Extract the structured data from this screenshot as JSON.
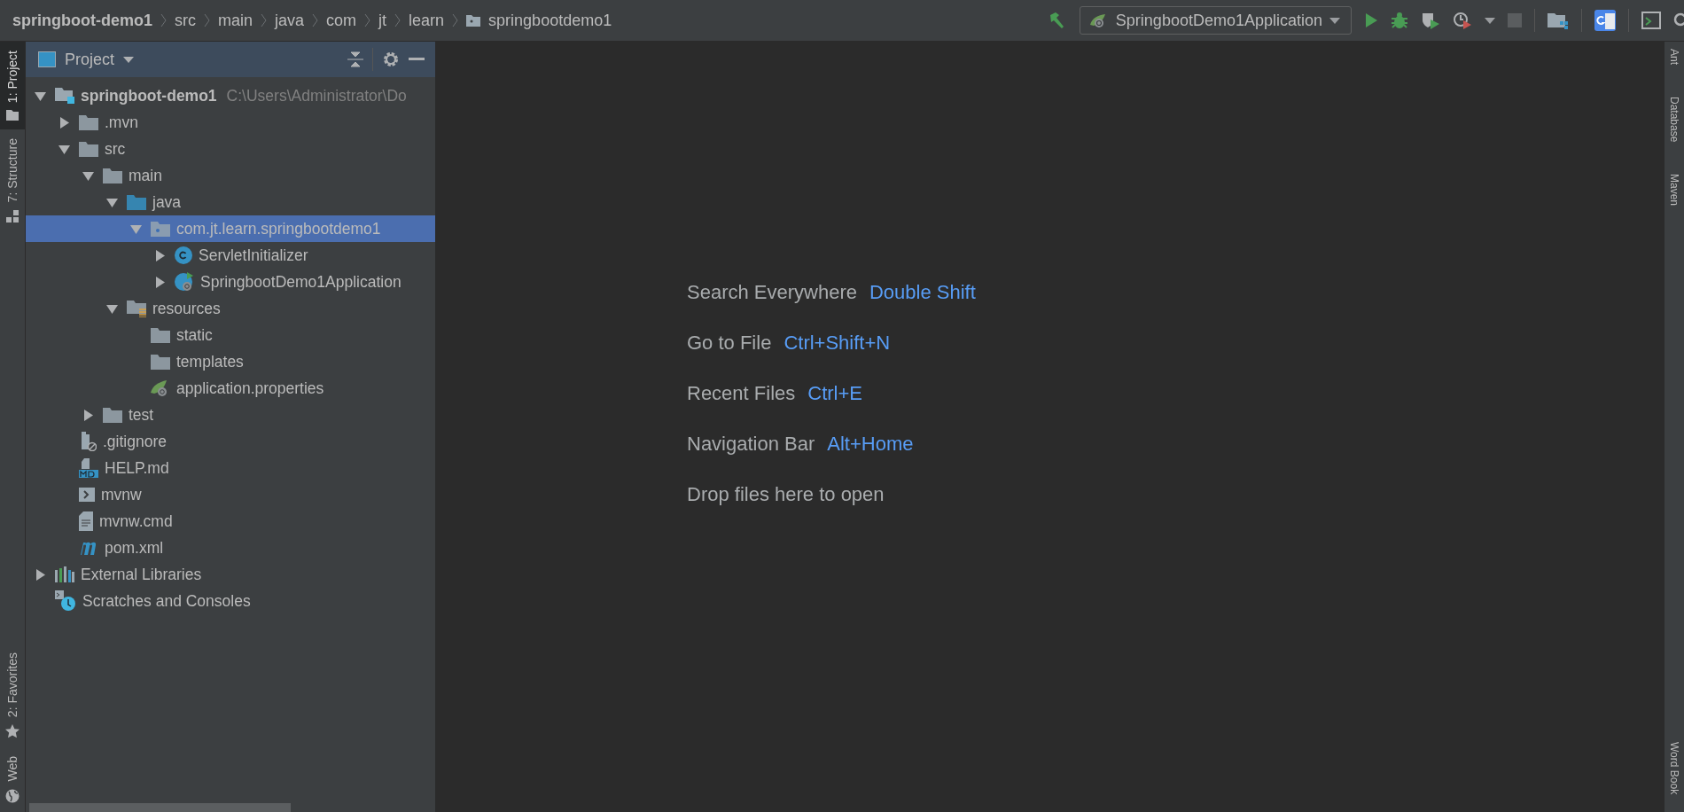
{
  "breadcrumb": [
    {
      "label": "springboot-demo1",
      "kind": "project"
    },
    {
      "label": "src",
      "kind": "plain"
    },
    {
      "label": "main",
      "kind": "plain"
    },
    {
      "label": "java",
      "kind": "plain"
    },
    {
      "label": "com",
      "kind": "plain"
    },
    {
      "label": "jt",
      "kind": "plain"
    },
    {
      "label": "learn",
      "kind": "plain"
    },
    {
      "label": "springbootdemo1",
      "kind": "package"
    }
  ],
  "run_config": {
    "label": "SpringbootDemo1Application"
  },
  "left_tool_windows": [
    {
      "label": "1: Project",
      "selected": true,
      "kind": "project"
    },
    {
      "label": "7: Structure",
      "selected": false,
      "kind": "structure"
    },
    {
      "label": "2: Favorites",
      "selected": false,
      "kind": "favorites"
    },
    {
      "label": "Web",
      "selected": false,
      "kind": "web"
    }
  ],
  "right_tool_windows": [
    {
      "label": "Ant"
    },
    {
      "label": "Database"
    },
    {
      "label": "Maven"
    },
    {
      "label": "Word Book"
    }
  ],
  "project_panel": {
    "title": "Project",
    "tree": [
      {
        "label": "springboot-demo1",
        "kind": "module",
        "hint": "C:\\Users\\Administrator\\Do",
        "expanded": true,
        "selected": false,
        "children": [
          {
            "label": ".mvn",
            "kind": "folder",
            "expanded": false,
            "selected": false
          },
          {
            "label": "src",
            "kind": "folder",
            "expanded": true,
            "selected": false,
            "children": [
              {
                "label": "main",
                "kind": "folder",
                "expanded": true,
                "selected": false,
                "children": [
                  {
                    "label": "java",
                    "kind": "source-folder",
                    "expanded": true,
                    "selected": false,
                    "children": [
                      {
                        "label": "com.jt.learn.springbootdemo1",
                        "kind": "package",
                        "expanded": true,
                        "selected": true,
                        "children": [
                          {
                            "label": "ServletInitializer",
                            "kind": "class",
                            "expanded": false,
                            "selected": false
                          },
                          {
                            "label": "SpringbootDemo1Application",
                            "kind": "spring-class",
                            "expanded": false,
                            "selected": false
                          }
                        ]
                      }
                    ]
                  },
                  {
                    "label": "resources",
                    "kind": "resources-folder",
                    "expanded": true,
                    "selected": false,
                    "children": [
                      {
                        "label": "static",
                        "kind": "folder",
                        "selected": false
                      },
                      {
                        "label": "templates",
                        "kind": "folder",
                        "selected": false
                      },
                      {
                        "label": "application.properties",
                        "kind": "spring-properties",
                        "selected": false
                      }
                    ]
                  }
                ]
              },
              {
                "label": "test",
                "kind": "folder",
                "expanded": false,
                "selected": false
              }
            ]
          },
          {
            "label": ".gitignore",
            "kind": "ignore-file",
            "selected": false
          },
          {
            "label": "HELP.md",
            "kind": "markdown",
            "selected": false
          },
          {
            "label": "mvnw",
            "kind": "shell",
            "selected": false
          },
          {
            "label": "mvnw.cmd",
            "kind": "text-file",
            "selected": false
          },
          {
            "label": "pom.xml",
            "kind": "maven",
            "selected": false
          }
        ]
      },
      {
        "label": "External Libraries",
        "kind": "libraries",
        "expanded": false,
        "selected": false
      },
      {
        "label": "Scratches and Consoles",
        "kind": "scratches",
        "selected": false
      }
    ]
  },
  "editor_hints": [
    {
      "label": "Search Everywhere",
      "shortcut": "Double Shift"
    },
    {
      "label": "Go to File",
      "shortcut": "Ctrl+Shift+N"
    },
    {
      "label": "Recent Files",
      "shortcut": "Ctrl+E"
    },
    {
      "label": "Navigation Bar",
      "shortcut": "Alt+Home"
    },
    {
      "label": "Drop files here to open"
    }
  ]
}
